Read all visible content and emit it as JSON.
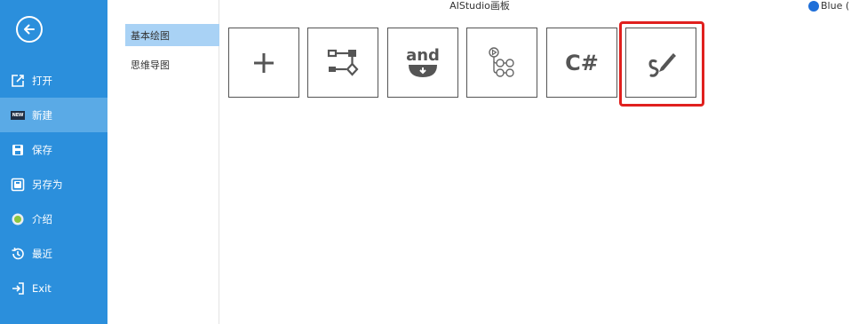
{
  "app": {
    "title": "AIStudio画板",
    "theme_label": "Blue ("
  },
  "colors": {
    "sidebar_bg": "#2b8fdc",
    "sidebar_active": "#5aaae6",
    "category_selected": "#a9d2f5",
    "highlight": "#e0201e"
  },
  "sidebar": {
    "back_icon": "arrow-left-circle-icon",
    "items": [
      {
        "label": "打开",
        "icon": "open-folder-icon",
        "active": false
      },
      {
        "label": "新建",
        "icon": "new-badge-icon",
        "badge": "NEW",
        "active": true
      },
      {
        "label": "保存",
        "icon": "save-icon",
        "active": false
      },
      {
        "label": "另存为",
        "icon": "save-as-icon",
        "active": false
      },
      {
        "label": "介绍",
        "icon": "info-circle-icon",
        "active": false
      },
      {
        "label": "最近",
        "icon": "history-icon",
        "active": false
      },
      {
        "label": "Exit",
        "icon": "exit-icon",
        "active": false
      }
    ]
  },
  "categories": [
    {
      "label": "基本绘图",
      "selected": true
    },
    {
      "label": "思维导图",
      "selected": false
    }
  ],
  "templates": [
    {
      "icon": "plus-icon"
    },
    {
      "icon": "flowchart-icon"
    },
    {
      "icon": "and-gate-icon",
      "text": "and"
    },
    {
      "icon": "workflow-icon"
    },
    {
      "icon": "csharp-icon",
      "text": "C#"
    },
    {
      "icon": "pen-draw-icon",
      "highlighted": true
    }
  ]
}
